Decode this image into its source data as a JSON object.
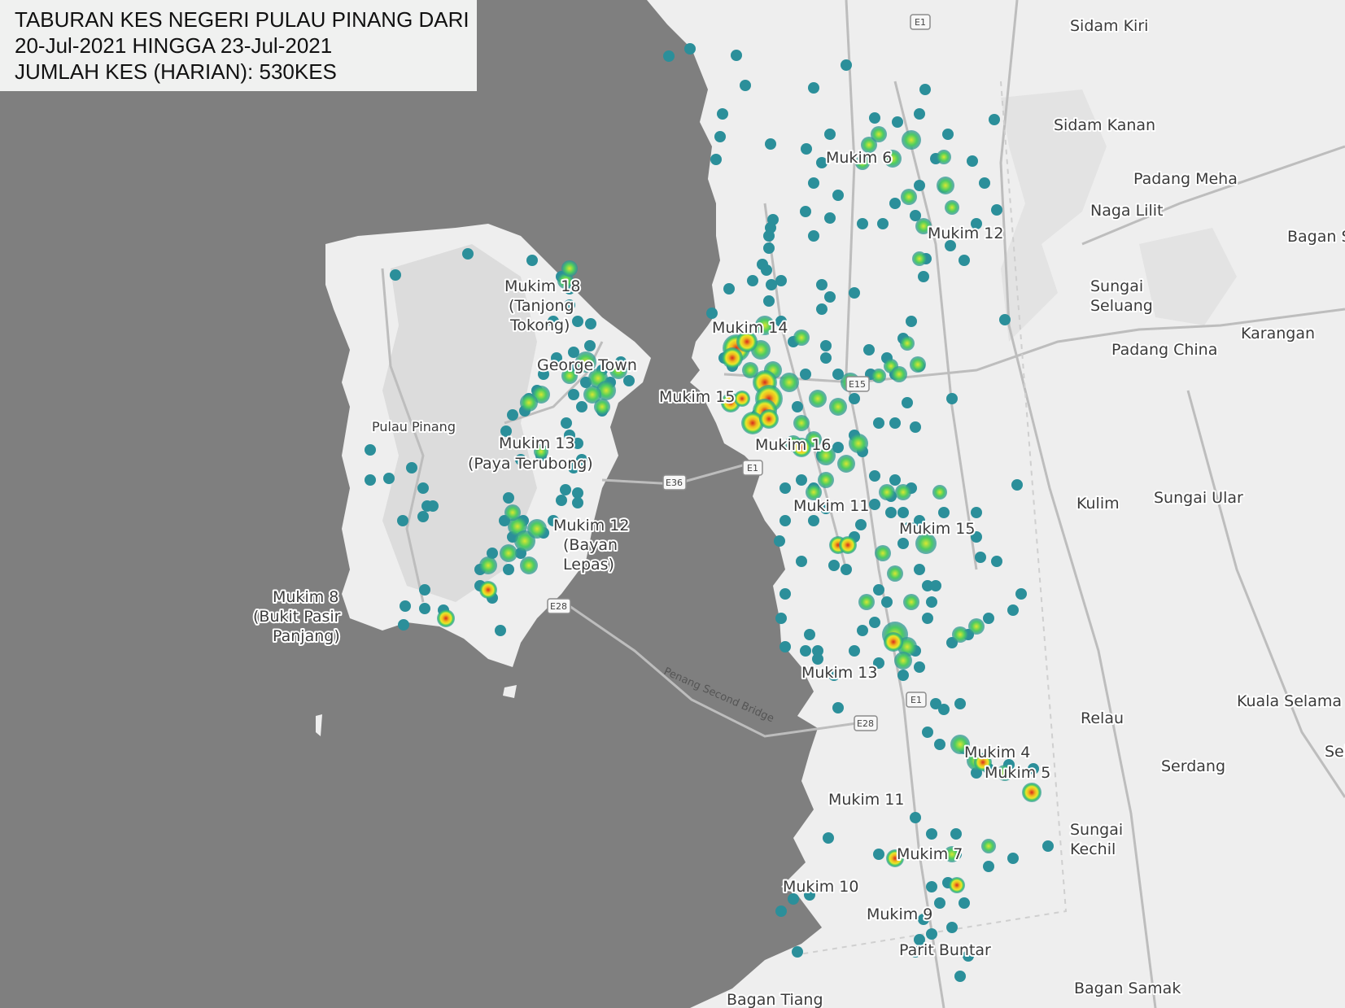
{
  "title": {
    "line1": "TABURAN KES NEGERI PULAU PINANG DARI",
    "line2": "20-Jul-2021 HINGGA 23-Jul-2021",
    "line3": "JUMLAH KES (HARIAN): 530KES"
  },
  "place_labels": [
    "Sidam Kiri",
    "Sidam Kanan",
    "Padang Meha",
    "Naga Lilit",
    "Bagan S",
    "Sungai",
    "Seluang",
    "Karangan",
    "Padang China",
    "Kulim",
    "Sungai Ular",
    "Relau",
    "Kuala Selama",
    "Sel",
    "Serdang",
    "Sungai",
    "Kechil",
    "Parit Buntar",
    "Bagan Samak",
    "Bagan Tiang",
    "Mukim 6",
    "Mukim 12",
    "Mukim 14",
    "Mukim 15",
    "Mukim 11",
    "Mukim 15",
    "Mukim 16",
    "Mukim 13",
    "Mukim 4",
    "Mukim 5",
    "Mukim 11",
    "Mukim 7",
    "Mukim 10",
    "Mukim 9",
    "Mukim 18",
    "(Tanjong",
    "Tokong)",
    "George Town",
    "Pulau Pinang",
    "Mukim 13",
    "(Paya Terubong)",
    "Mukim 12",
    "(Bayan",
    "Lepas)",
    "Mukim 8",
    "(Bukit Pasir",
    "Panjang)",
    "Penang Second Bridge"
  ],
  "road_shields": [
    "E1",
    "E15",
    "E36",
    "E1",
    "E28",
    "E1",
    "E28"
  ],
  "heatmap": {
    "colors": {
      "low": "#2b8f9a",
      "medium": "#3cc46a",
      "high": "#e8e82a",
      "peak": "#d62a1e",
      "water": "#7f7f7f",
      "land": "#eeeeee"
    }
  }
}
